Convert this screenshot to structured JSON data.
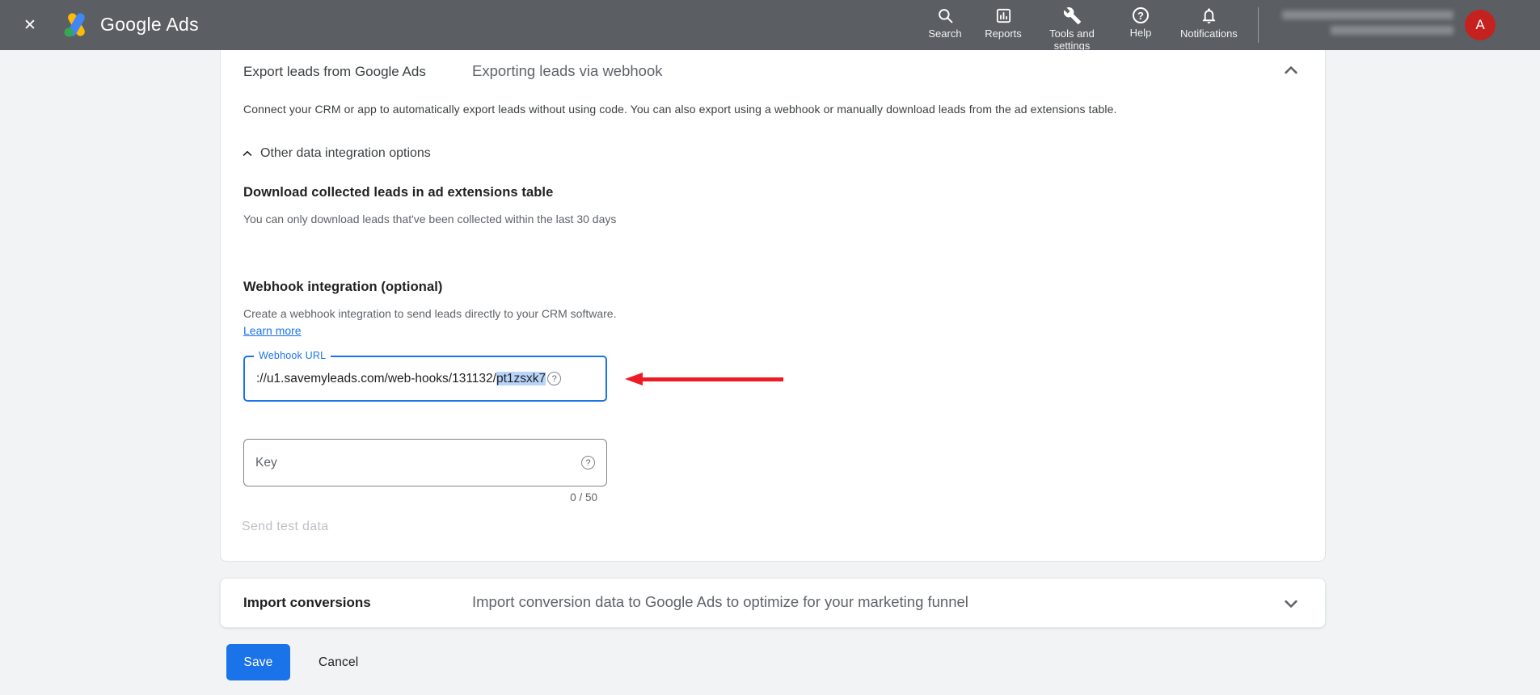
{
  "colors": {
    "accent_blue": "#1a73e8",
    "topbar_bg": "#5b5e62",
    "page_bg": "#f1f3f4",
    "arrow_red": "#ed1c24",
    "avatar_red": "#c5221f",
    "text_selection": "#b8d4f8",
    "disabled_text": "#bdc1c6"
  },
  "header": {
    "close_glyph": "✕",
    "brand": "Google Ads",
    "nav": [
      {
        "label": "Search"
      },
      {
        "label": "Reports"
      },
      {
        "label": "Tools and settings"
      },
      {
        "label": "Help"
      },
      {
        "label": "Notifications"
      }
    ],
    "help_glyph": "?",
    "avatar_letter": "A"
  },
  "card": {
    "title": "Export leads from Google Ads",
    "subtitle": "Exporting leads via webhook",
    "description": "Connect your CRM or app to automatically export leads without using code. You can also export using a webhook or manually download leads from the ad extensions table.",
    "other_options_label": "Other data integration options",
    "download": {
      "heading": "Download collected leads in ad extensions table",
      "note": "You can only download leads that've been collected within the last 30 days"
    },
    "webhook": {
      "heading": "Webhook integration (optional)",
      "description": "Create a webhook integration to send leads directly to your CRM software.",
      "learn_more_label": "Learn more",
      "url_field": {
        "label": "Webhook URL",
        "value_prefix": "://u1.savemyleads.com/web-hooks/131132/",
        "value_selected": "pt1zsxk7",
        "help_glyph": "?"
      },
      "key_field": {
        "placeholder": "Key",
        "counter": "0 / 50",
        "help_glyph": "?"
      },
      "send_test_label": "Send test data"
    }
  },
  "import_conversions": {
    "title": "Import conversions",
    "description": "Import conversion data to Google Ads to optimize for your marketing funnel"
  },
  "actions": {
    "save_label": "Save",
    "cancel_label": "Cancel"
  }
}
